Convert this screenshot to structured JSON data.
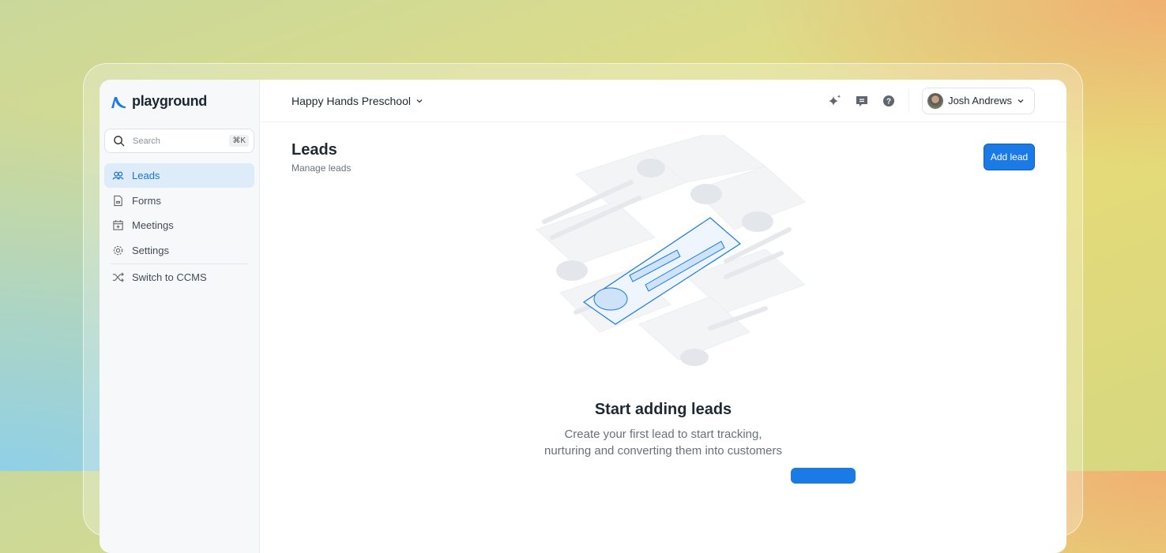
{
  "brand": {
    "name": "playground",
    "accent": "#1a7ae6"
  },
  "sidebar": {
    "search_placeholder": "Search",
    "search_shortcut": "⌘K",
    "items": [
      {
        "label": "Leads",
        "icon": "users-icon",
        "active": true
      },
      {
        "label": "Forms",
        "icon": "document-icon"
      },
      {
        "label": "Meetings",
        "icon": "calendar-icon"
      },
      {
        "label": "Settings",
        "icon": "gear-icon"
      }
    ],
    "switch_label": "Switch to CCMS"
  },
  "header": {
    "org": "Happy Hands Preschool",
    "user": "Josh Andrews",
    "icons": [
      "sparkle-icon",
      "message-icon",
      "help-icon"
    ]
  },
  "page": {
    "title": "Leads",
    "subtitle": "Manage leads",
    "add_button": "Add lead"
  },
  "empty": {
    "title": "Start adding leads",
    "line1": "Create your first lead to start tracking,",
    "line2": "nurturing and converting them into customers"
  }
}
